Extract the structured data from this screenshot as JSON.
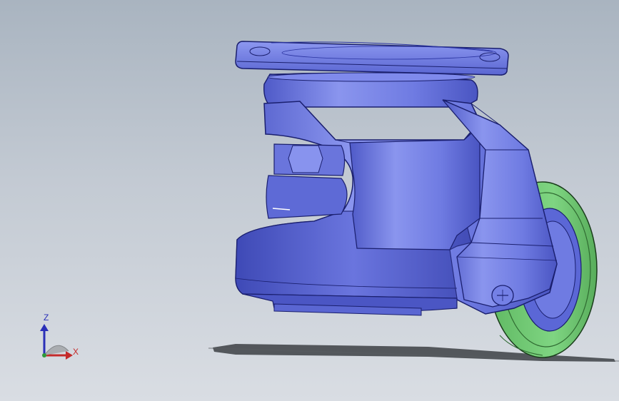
{
  "viewport": {
    "background_top": "#a9b4c0",
    "background_bottom": "#d9dde3"
  },
  "model": {
    "body_color": "#6f7de6",
    "body_shadow_color": "#4b56c4",
    "edge_color": "#1a1f6e",
    "wheel_tread_color": "#6cc46e",
    "shadow_color": "#3c3f44"
  },
  "triad": {
    "z_label": "Z",
    "x_label": "X",
    "z_color": "#2a2fb8",
    "x_color": "#c42a2a",
    "y_color": "#2e9a3a"
  }
}
